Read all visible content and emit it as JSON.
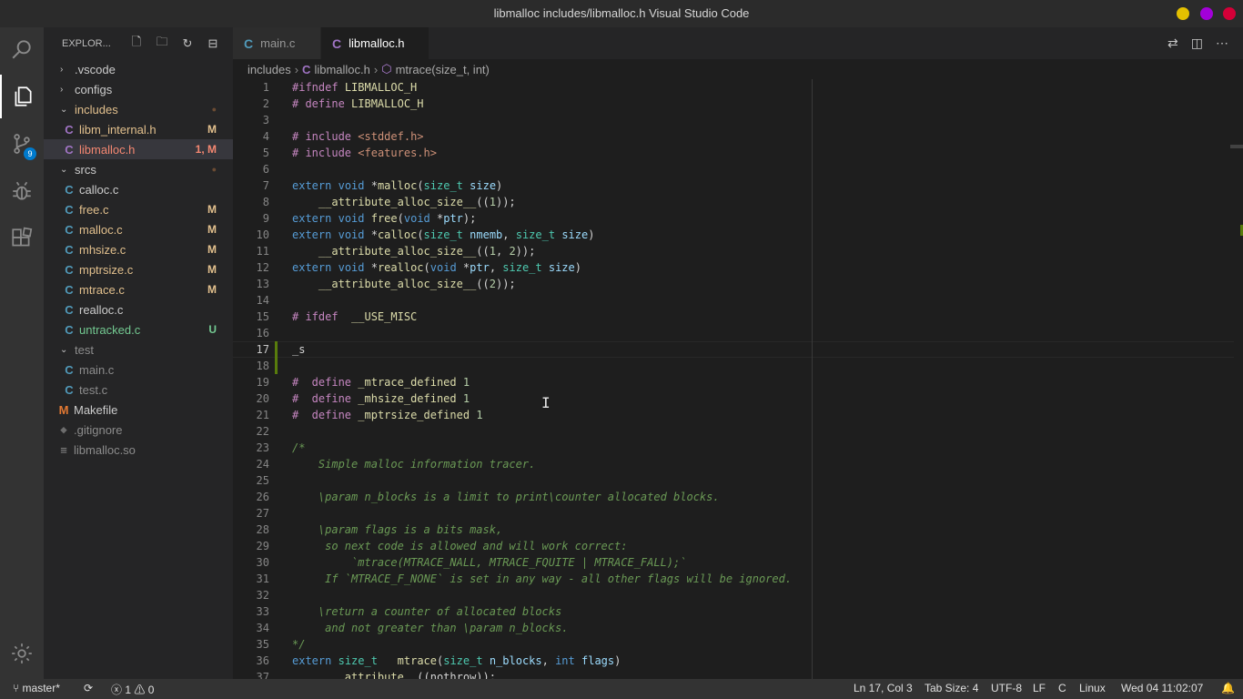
{
  "window": {
    "title": "libmalloc includes/libmalloc.h Visual Studio Code",
    "dots": [
      "#e4c000",
      "#a300d9",
      "#d40038"
    ]
  },
  "activity": {
    "items": [
      {
        "name": "search-icon"
      },
      {
        "name": "explorer-icon"
      },
      {
        "name": "source-control-icon",
        "badge": "9"
      },
      {
        "name": "debug-icon"
      },
      {
        "name": "extensions-icon"
      },
      {
        "name": "settings-gear-icon"
      }
    ]
  },
  "explorer": {
    "header": "EXPLOR...",
    "header_icons": [
      "new-file-icon",
      "new-folder-icon",
      "refresh-icon",
      "collapse-all-icon"
    ],
    "rows": [
      {
        "label": ".vscode",
        "type": "folder",
        "open": false,
        "depth": 1,
        "color": "#cccccc",
        "status": "",
        "status_color": ""
      },
      {
        "label": "configs",
        "type": "folder",
        "open": false,
        "depth": 1,
        "color": "#cccccc",
        "status": "",
        "status_color": ""
      },
      {
        "label": "includes",
        "type": "folder",
        "open": true,
        "depth": 1,
        "color": "#e2c08d",
        "status": "●",
        "status_color": "#6b4b33"
      },
      {
        "label": "libm_internal.h",
        "type": "c",
        "depth": 2,
        "color": "#e2c08d",
        "status": "M",
        "status_color": "#e2c08d"
      },
      {
        "label": "libmalloc.h",
        "type": "c",
        "depth": 2,
        "color": "#f48771",
        "status": "1, M",
        "status_color": "#f48771",
        "selected": true
      },
      {
        "label": "srcs",
        "type": "folder",
        "open": true,
        "depth": 1,
        "color": "#cccccc",
        "status": "●",
        "status_color": "#6b4b33"
      },
      {
        "label": "calloc.c",
        "type": "c",
        "depth": 2,
        "color": "#cccccc",
        "status": "",
        "status_color": ""
      },
      {
        "label": "free.c",
        "type": "c",
        "depth": 2,
        "color": "#e2c08d",
        "status": "M",
        "status_color": "#e2c08d"
      },
      {
        "label": "malloc.c",
        "type": "c",
        "depth": 2,
        "color": "#e2c08d",
        "status": "M",
        "status_color": "#e2c08d"
      },
      {
        "label": "mhsize.c",
        "type": "c",
        "depth": 2,
        "color": "#e2c08d",
        "status": "M",
        "status_color": "#e2c08d"
      },
      {
        "label": "mptrsize.c",
        "type": "c",
        "depth": 2,
        "color": "#e2c08d",
        "status": "M",
        "status_color": "#e2c08d"
      },
      {
        "label": "mtrace.c",
        "type": "c",
        "depth": 2,
        "color": "#e2c08d",
        "status": "M",
        "status_color": "#e2c08d"
      },
      {
        "label": "realloc.c",
        "type": "c",
        "depth": 2,
        "color": "#cccccc",
        "status": "",
        "status_color": ""
      },
      {
        "label": "untracked.c",
        "type": "c",
        "depth": 2,
        "color": "#73c991",
        "status": "U",
        "status_color": "#73c991"
      },
      {
        "label": "test",
        "type": "folder",
        "open": true,
        "depth": 1,
        "color": "#8c8c8c",
        "status": "",
        "status_color": ""
      },
      {
        "label": "main.c",
        "type": "c",
        "depth": 2,
        "color": "#8c8c8c",
        "status": "",
        "status_color": ""
      },
      {
        "label": "test.c",
        "type": "c",
        "depth": 2,
        "color": "#8c8c8c",
        "status": "",
        "status_color": ""
      },
      {
        "label": "Makefile",
        "type": "make",
        "depth": 1,
        "color": "#cccccc",
        "status": "",
        "status_color": ""
      },
      {
        "label": ".gitignore",
        "type": "git",
        "depth": 1,
        "color": "#8c8c8c",
        "status": "",
        "status_color": ""
      },
      {
        "label": "libmalloc.so",
        "type": "bin",
        "depth": 1,
        "color": "#8c8c8c",
        "status": "",
        "status_color": ""
      }
    ]
  },
  "tabs": [
    {
      "label": "main.c",
      "active": false
    },
    {
      "label": "libmalloc.h",
      "active": true
    }
  ],
  "breadcrumb": {
    "folder": "includes",
    "file": "libmalloc.h",
    "symbol": "mtrace(size_t, int)"
  },
  "editor": {
    "current_line": 17,
    "lines": [
      {
        "n": "1",
        "html": "<span class='pp'>#ifndef</span> <span class='mac'>LIBMALLOC_H</span>"
      },
      {
        "n": "2",
        "html": "<span class='pp'># define</span> <span class='mac'>LIBMALLOC_H</span>"
      },
      {
        "n": "3",
        "html": ""
      },
      {
        "n": "4",
        "html": "<span class='pp'># include</span> <span class='str'>&lt;stddef.h&gt;</span>"
      },
      {
        "n": "5",
        "html": "<span class='pp'># include</span> <span class='str'>&lt;features.h&gt;</span>"
      },
      {
        "n": "6",
        "html": ""
      },
      {
        "n": "7",
        "html": "<span class='kw'>extern</span> <span class='kw'>void</span> *<span class='fn'>malloc</span>(<span class='ty'>size_t</span> <span class='par'>size</span>)"
      },
      {
        "n": "8",
        "html": "    <span class='mac'>__attribute_alloc_size__</span>((<span class='num'>1</span>));"
      },
      {
        "n": "9",
        "html": "<span class='kw'>extern</span> <span class='kw'>void</span> <span class='fn'>free</span>(<span class='kw'>void</span> *<span class='par'>ptr</span>);"
      },
      {
        "n": "10",
        "html": "<span class='kw'>extern</span> <span class='kw'>void</span> *<span class='fn'>calloc</span>(<span class='ty'>size_t</span> <span class='par'>nmemb</span>, <span class='ty'>size_t</span> <span class='par'>size</span>)"
      },
      {
        "n": "11",
        "html": "    <span class='mac'>__attribute_alloc_size__</span>((<span class='num'>1</span>, <span class='num'>2</span>));"
      },
      {
        "n": "12",
        "html": "<span class='kw'>extern</span> <span class='kw'>void</span> *<span class='fn'>realloc</span>(<span class='kw'>void</span> *<span class='par'>ptr</span>, <span class='ty'>size_t</span> <span class='par'>size</span>)"
      },
      {
        "n": "13",
        "html": "    <span class='mac'>__attribute_alloc_size__</span>((<span class='num'>2</span>));"
      },
      {
        "n": "14",
        "html": ""
      },
      {
        "n": "15",
        "html": "<span class='pp'># ifdef</span>  <span class='mac'>__USE_MISC</span>"
      },
      {
        "n": "16",
        "html": ""
      },
      {
        "n": "17",
        "html": "_s"
      },
      {
        "n": "18",
        "html": ""
      },
      {
        "n": "19",
        "html": "<span class='pp'>#  define</span> <span class='mac'>_mtrace_defined</span> <span class='num'>1</span>"
      },
      {
        "n": "20",
        "html": "<span class='pp'>#  define</span> <span class='mac'>_mhsize_defined</span> <span class='num'>1</span>"
      },
      {
        "n": "21",
        "html": "<span class='pp'>#  define</span> <span class='mac'>_mptrsize_defined</span> <span class='num'>1</span>"
      },
      {
        "n": "22",
        "html": ""
      },
      {
        "n": "23",
        "html": "<span class='cm'>/*</span>"
      },
      {
        "n": "24",
        "html": "<span class='cm'>    Simple malloc information tracer.</span>"
      },
      {
        "n": "25",
        "html": ""
      },
      {
        "n": "26",
        "html": "<span class='cm'>    \\param n_blocks is a limit to print\\counter allocated blocks.</span>"
      },
      {
        "n": "27",
        "html": ""
      },
      {
        "n": "28",
        "html": "<span class='cm'>    \\param flags is a bits mask,</span>"
      },
      {
        "n": "29",
        "html": "<span class='cm'>     so next code is allowed and will work correct:</span>"
      },
      {
        "n": "30",
        "html": "<span class='cm'>         `mtrace(MTRACE_NALL, MTRACE_FQUITE | MTRACE_FALL);`</span>"
      },
      {
        "n": "31",
        "html": "<span class='cm'>     If `MTRACE_F_NONE` is set in any way - all other flags will be ignored.</span>"
      },
      {
        "n": "32",
        "html": ""
      },
      {
        "n": "33",
        "html": "<span class='cm'>    \\return a counter of allocated blocks</span>"
      },
      {
        "n": "34",
        "html": "<span class='cm'>     and not greater than \\param n_blocks.</span>"
      },
      {
        "n": "35",
        "html": "<span class='cm'>*/</span>"
      },
      {
        "n": "36",
        "html": "<span class='kw'>extern</span> <span class='ty'>size_t</span>   <span class='fn'>mtrace</span>(<span class='ty'>size_t</span> <span class='par'>n_blocks</span>, <span class='kw'>int</span> <span class='par'>flags</span>)"
      },
      {
        "n": "37",
        "html": "      <span class='mac'>__attribute__</span>((nothrow));"
      }
    ]
  },
  "statusbar": {
    "branch": "master*",
    "sync": "⟳",
    "errors": "1",
    "warnings": "0",
    "position": "Ln 17, Col 3",
    "tab_size": "Tab Size: 4",
    "encoding": "UTF-8",
    "eol": "LF",
    "language": "C",
    "os": "Linux",
    "datetime": "Wed 04 11:02:07"
  }
}
